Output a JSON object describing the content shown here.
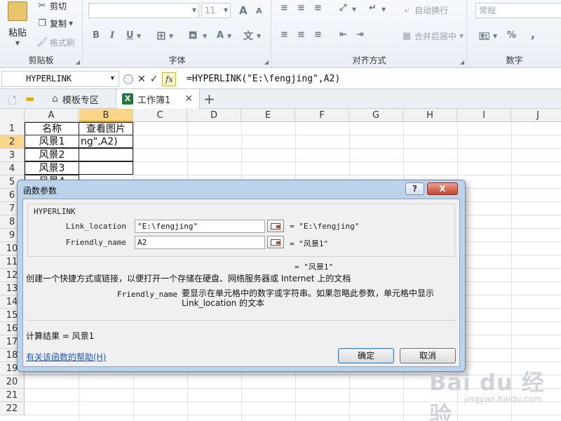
{
  "ribbon": {
    "clipboard": {
      "paste_label": "粘贴",
      "cut_label": "剪切",
      "copy_label": "复制",
      "format_painter_label": "格式刷",
      "group_label": "剪贴板"
    },
    "font": {
      "font_size": "11",
      "bold": "B",
      "italic": "I",
      "underline": "U",
      "grow": "A",
      "shrink": "A",
      "font_color": "A",
      "group_label": "字体"
    },
    "alignment": {
      "wrap_text_label": "自动换行",
      "merge_center_label": "合并后居中",
      "group_label": "对齐方式"
    },
    "number": {
      "format_value": "常规",
      "percent": "%",
      "comma": ",",
      "group_label": "数字"
    }
  },
  "formula_bar": {
    "name_box": "HYPERLINK",
    "fx": "fx",
    "formula": "=HYPERLINK(\"E:\\fengjing\",A2)"
  },
  "tabs": {
    "template_tab": "模板专区",
    "workbook_tab": "工作簿1",
    "xl_badge": "X"
  },
  "grid": {
    "columns": [
      "A",
      "B",
      "C",
      "D",
      "E",
      "F",
      "G",
      "H",
      "I",
      "J"
    ],
    "rows": [
      "1",
      "2",
      "3",
      "4",
      "5",
      "6",
      "7",
      "8",
      "9",
      "10",
      "11",
      "12",
      "13",
      "14",
      "15",
      "16",
      "17",
      "18",
      "19",
      "20",
      "21",
      "22"
    ],
    "cells": {
      "A1": "名称",
      "B1": "查看图片",
      "A2": "风景1",
      "B2": "ng\",A2)",
      "A3": "风景2",
      "A4": "风景3",
      "A5": "风景4"
    }
  },
  "dialog": {
    "title": "函数参数",
    "help_glyph": "?",
    "close_glyph": "X",
    "function_name": "HYPERLINK",
    "args": [
      {
        "label": "Link_location",
        "value": "\"E:\\fengjing\"",
        "result": "= \"E:\\fengjing\""
      },
      {
        "label": "Friendly_name",
        "value": "A2",
        "result": "= \"风景1\""
      }
    ],
    "formula_result": "= \"风景1\"",
    "description": "创建一个快捷方式或链接，以便打开一个存储在硬盘、网络服务器或  Internet 上的文档",
    "arg_desc_name": "Friendly_name",
    "arg_desc_text": "要显示在单元格中的数字或字符串。如果忽略此参数，单元格中显示 Link_location 的文本",
    "calc_result": "计算结果 =  风景1",
    "help_link": "有关该函数的帮助(H)",
    "ok_label": "确定",
    "cancel_label": "取消"
  },
  "watermark": {
    "logo": "Bai du 经验",
    "sub": "jingyan.baidu.com"
  }
}
